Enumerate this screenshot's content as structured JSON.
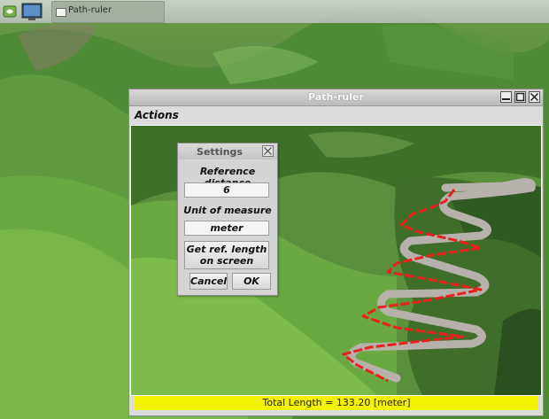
{
  "taskbar": {
    "task_label": "Path-ruler",
    "task_icon": "window-icon",
    "menu_icon": "app-menu-icon",
    "show_desktop_icon": "show-desktop-icon"
  },
  "window": {
    "title": "Path-ruler",
    "menu": {
      "actions_label": "Actions"
    },
    "controls": [
      "minimize-icon",
      "maximize-icon",
      "close-icon"
    ],
    "status": "Total Length = 133.20 [meter]"
  },
  "dialog": {
    "title": "Settings",
    "reference_distance_label": "Reference distance",
    "reference_distance_value": "6",
    "unit_label": "Unit of measure",
    "unit_value": "meter",
    "get_ref_line1": "Get ref. length",
    "get_ref_line2": "on screen",
    "cancel_label": "Cancel",
    "ok_label": "OK"
  },
  "colors": {
    "path_line": "#e8221c",
    "status_bar": "#f3f300",
    "taskbar_accent": "#7ab24e"
  }
}
